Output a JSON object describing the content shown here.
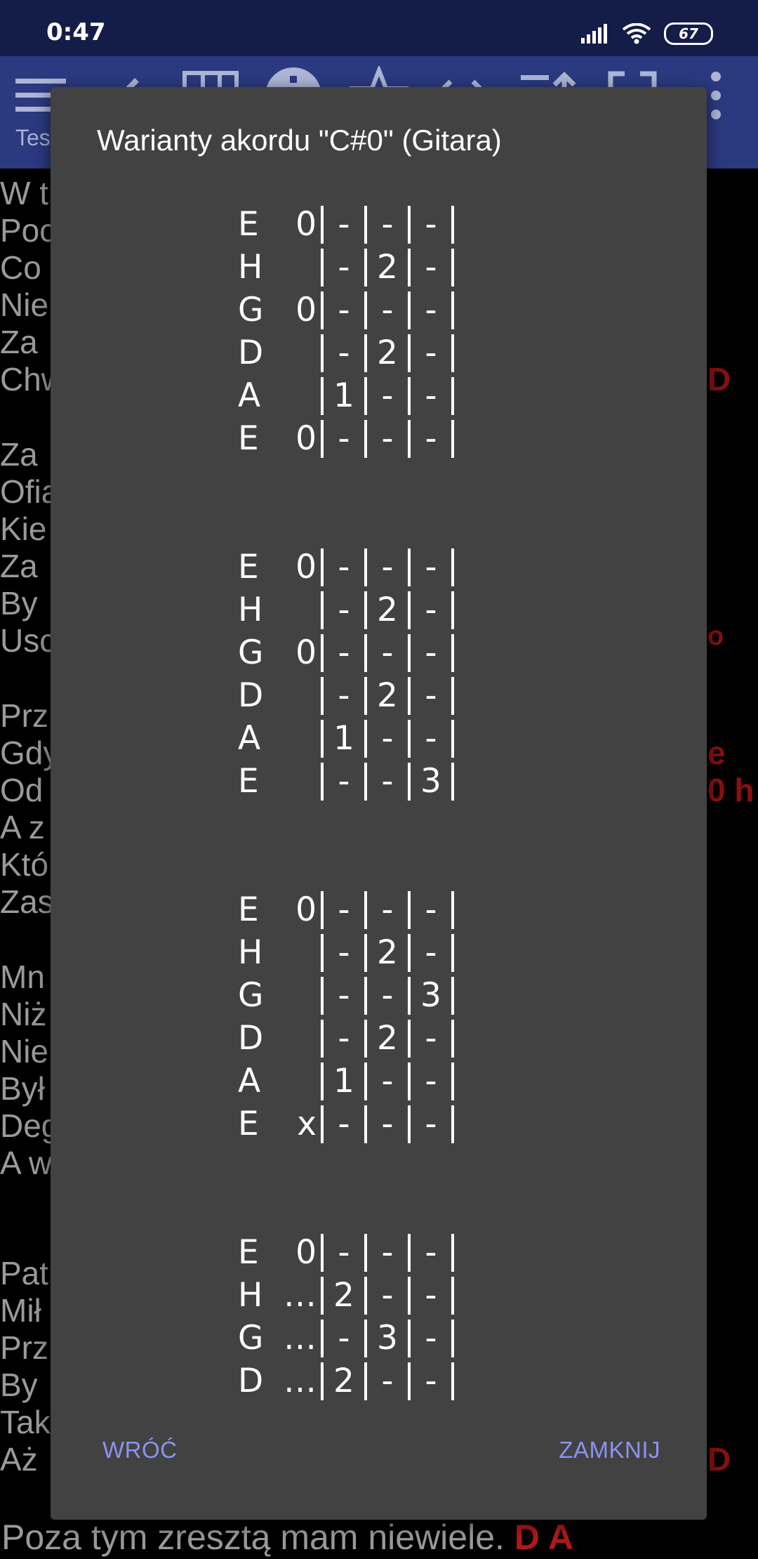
{
  "status_bar": {
    "time": "0:47",
    "battery": "67",
    "icons": [
      "signal-icon",
      "wifi-icon",
      "battery-icon"
    ]
  },
  "app_bar": {
    "subtitle": "Tes",
    "tools": [
      "menu-icon",
      "back-icon",
      "grid-icon",
      "info-icon",
      "star-icon",
      "code-icon",
      "sort-icon",
      "fullscreen-icon",
      "more-vert-icon"
    ]
  },
  "background_lyrics": [
    "W t",
    "Poc",
    "Co",
    "Nie",
    "Za",
    "Chw",
    "Za",
    "Ofia",
    "Kie",
    "Za",
    "By",
    "Usc",
    "Prz",
    "Gdy",
    "Od",
    "A z",
    "Któ",
    "Zas",
    "Mn",
    "Niż",
    "Nie",
    "Był",
    "Deg",
    "A w",
    "Pat",
    "Mił",
    "Prz",
    "By",
    "Tak",
    "Aż"
  ],
  "background_chords": [
    "D",
    "o",
    "e",
    "0 h",
    "D"
  ],
  "bottom_line": {
    "text": "Poza tym zresztą mam niewiele.",
    "chords": "D A"
  },
  "dialog": {
    "title": "Warianty akordu \"C#0\" (Gitara)",
    "back_label": "WRÓĆ",
    "close_label": "ZAMKNIJ",
    "variants": [
      [
        {
          "string": "E",
          "open": "0",
          "frets": [
            "-",
            "-",
            "-"
          ]
        },
        {
          "string": "H",
          "open": "",
          "frets": [
            "-",
            "2",
            "-"
          ]
        },
        {
          "string": "G",
          "open": "0",
          "frets": [
            "-",
            "-",
            "-"
          ]
        },
        {
          "string": "D",
          "open": "",
          "frets": [
            "-",
            "2",
            "-"
          ]
        },
        {
          "string": "A",
          "open": "",
          "frets": [
            "1",
            "-",
            "-"
          ]
        },
        {
          "string": "E",
          "open": "0",
          "frets": [
            "-",
            "-",
            "-"
          ]
        }
      ],
      [
        {
          "string": "E",
          "open": "0",
          "frets": [
            "-",
            "-",
            "-"
          ]
        },
        {
          "string": "H",
          "open": "",
          "frets": [
            "-",
            "2",
            "-"
          ]
        },
        {
          "string": "G",
          "open": "0",
          "frets": [
            "-",
            "-",
            "-"
          ]
        },
        {
          "string": "D",
          "open": "",
          "frets": [
            "-",
            "2",
            "-"
          ]
        },
        {
          "string": "A",
          "open": "",
          "frets": [
            "1",
            "-",
            "-"
          ]
        },
        {
          "string": "E",
          "open": "",
          "frets": [
            "-",
            "-",
            "3"
          ]
        }
      ],
      [
        {
          "string": "E",
          "open": "0",
          "frets": [
            "-",
            "-",
            "-"
          ]
        },
        {
          "string": "H",
          "open": "",
          "frets": [
            "-",
            "2",
            "-"
          ]
        },
        {
          "string": "G",
          "open": "",
          "frets": [
            "-",
            "-",
            "3"
          ]
        },
        {
          "string": "D",
          "open": "",
          "frets": [
            "-",
            "2",
            "-"
          ]
        },
        {
          "string": "A",
          "open": "",
          "frets": [
            "1",
            "-",
            "-"
          ]
        },
        {
          "string": "E",
          "open": "x",
          "frets": [
            "-",
            "-",
            "-"
          ]
        }
      ],
      [
        {
          "string": "E",
          "open": "0",
          "frets": [
            "-",
            "-",
            "-"
          ]
        },
        {
          "string": "H",
          "open": "…",
          "frets": [
            "2",
            "-",
            "-"
          ]
        },
        {
          "string": "G",
          "open": "…",
          "frets": [
            "-",
            "3",
            "-"
          ]
        },
        {
          "string": "D",
          "open": "…",
          "frets": [
            "2",
            "-",
            "-"
          ]
        }
      ]
    ]
  }
}
